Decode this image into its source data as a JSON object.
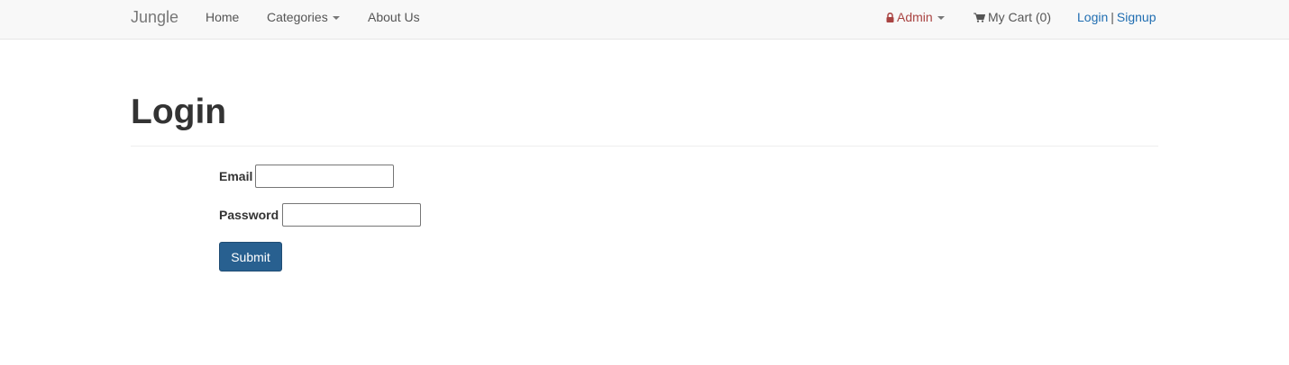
{
  "navbar": {
    "brand": "Jungle",
    "home": "Home",
    "categories": "Categories",
    "about": "About Us",
    "admin": "Admin",
    "cart": "My Cart (0)",
    "login": "Login",
    "separator": "|",
    "signup": "Signup"
  },
  "page": {
    "title": "Login"
  },
  "form": {
    "email_label": "Email",
    "email_value": "",
    "password_label": "Password",
    "password_value": "",
    "submit_label": "Submit"
  },
  "colors": {
    "navbar_bg": "#f8f8f8",
    "admin_text": "#a94442",
    "link": "#1f6db1",
    "primary_button": "#286090"
  },
  "icons": {
    "admin": "lock-icon",
    "cart": "shopping-cart-icon",
    "dropdown": "caret-down-icon"
  }
}
